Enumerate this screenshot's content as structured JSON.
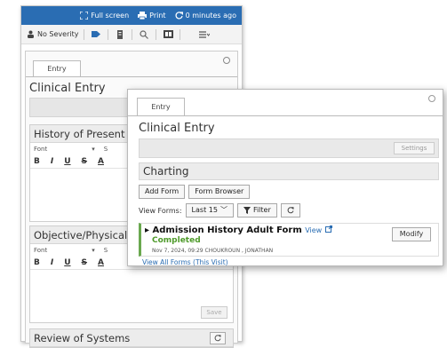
{
  "topbar": {
    "full_screen": "Full screen",
    "print": "Print",
    "refresh_time": "0 minutes ago"
  },
  "toolbar": {
    "severity_label": "No Severity"
  },
  "back": {
    "tab_label": "Entry",
    "title": "Clinical Entry",
    "sections": [
      {
        "header": "History of Present",
        "font_label": "Font",
        "size_label": "S",
        "fmt": [
          "B",
          "I",
          "U",
          "S",
          "A"
        ]
      },
      {
        "header": "Objective/Physical",
        "font_label": "Font",
        "size_label": "S",
        "fmt": [
          "B",
          "I",
          "U",
          "S",
          "A"
        ],
        "save_label": "Save"
      },
      {
        "header": "Review of Systems"
      }
    ]
  },
  "front": {
    "tab_label": "Entry",
    "title": "Clinical Entry",
    "settings_label": "Settings",
    "charting_header": "Charting",
    "add_form_label": "Add Form",
    "form_browser_label": "Form Browser",
    "view_forms_label": "View Forms:",
    "view_forms_value": "Last 15",
    "filter_label": "Filter",
    "form": {
      "name": "Admission History Adult Form",
      "view_label": "View",
      "status": "Completed",
      "meta": "Nov 7, 2024, 09:29  CHOUKROUN , JONATHAN",
      "modify_label": "Modify"
    },
    "view_all_label": "View All Forms (This Visit)"
  },
  "colors": {
    "accent": "#2a6db3",
    "status_green": "#4e9a2a"
  }
}
